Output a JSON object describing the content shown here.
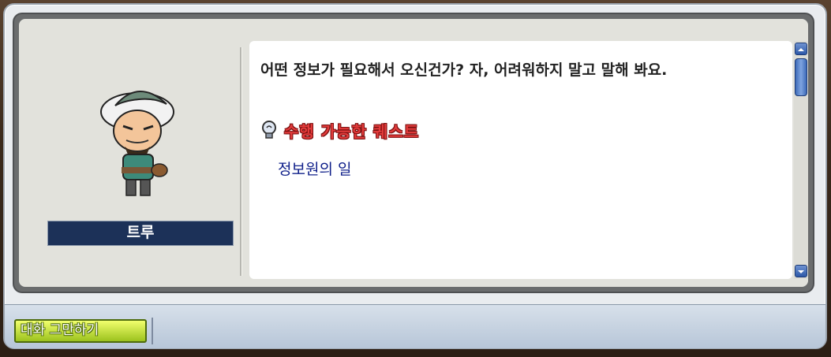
{
  "npc": {
    "name": "트루",
    "sprite_icon": "npc-portrait-icon"
  },
  "dialog": {
    "text": "어떤 정보가 필요해서 오신건가? 자, 어려워하지 말고 말해 봐요.",
    "quest_header": "수행 가능한 퀘스트",
    "quest_header_icon": "lightbulb-icon",
    "quests": [
      "정보원의 일"
    ]
  },
  "footer": {
    "end_chat_label": "대화 그만하기"
  },
  "colors": {
    "nameplate_bg": "#1c3158",
    "quest_header": "#e23b3b",
    "quest_link": "#10208a",
    "end_button": "#c9e33a"
  }
}
